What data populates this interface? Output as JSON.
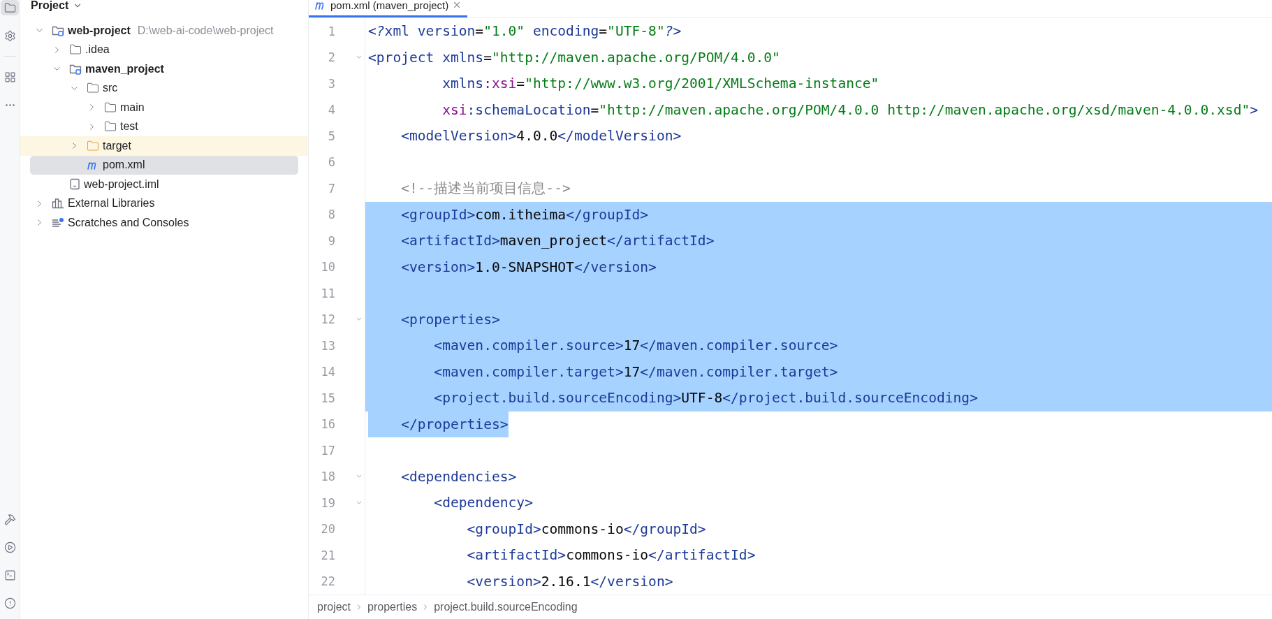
{
  "tool_strip": {
    "top": [
      {
        "kind": "project",
        "selected": true
      },
      {
        "kind": "settings",
        "selected": false
      },
      {
        "kind": "structure",
        "selected": false
      },
      {
        "kind": "more",
        "selected": false
      }
    ],
    "bottom": [
      {
        "kind": "build",
        "selected": false
      },
      {
        "kind": "services",
        "selected": false
      },
      {
        "kind": "terminal",
        "selected": false
      },
      {
        "kind": "problems",
        "selected": false
      }
    ]
  },
  "project_panel": {
    "title": "Project",
    "tree": [
      {
        "label": "web-project",
        "path": "D:\\web-ai-code\\web-project",
        "kind": "module",
        "expanded": true,
        "selected": false,
        "children": [
          {
            "label": ".idea",
            "kind": "folder",
            "expanded": false,
            "selected": false
          },
          {
            "label": "maven_project",
            "kind": "module",
            "expanded": true,
            "selected": false,
            "children": [
              {
                "label": "src",
                "kind": "folder",
                "expanded": true,
                "selected": false,
                "children": [
                  {
                    "label": "main",
                    "kind": "folder",
                    "expanded": false,
                    "selected": false
                  },
                  {
                    "label": "test",
                    "kind": "folder",
                    "expanded": false,
                    "selected": false
                  }
                ]
              },
              {
                "label": "target",
                "kind": "excluded_folder",
                "expanded": false,
                "selected": false
              },
              {
                "label": "pom.xml",
                "kind": "maven_file",
                "selected": true
              }
            ]
          },
          {
            "label": "web-project.iml",
            "kind": "iml_file",
            "selected": false
          }
        ]
      },
      {
        "label": "External Libraries",
        "kind": "libraries",
        "expanded": false,
        "selected": false
      },
      {
        "label": "Scratches and Consoles",
        "kind": "scratches",
        "expanded": false,
        "selected": false
      }
    ]
  },
  "editor": {
    "tab": {
      "title": "pom.xml (maven_project)",
      "selected": true
    },
    "lines": [
      {
        "number": "1",
        "selected": false,
        "fold": false,
        "tokens": [
          {
            "kind": "pi",
            "text": "<?"
          },
          {
            "kind": "tag",
            "text": "xml"
          },
          {
            "kind": "attr",
            "text": " version"
          },
          {
            "kind": "text",
            "text": "="
          },
          {
            "kind": "str",
            "text": "\"1.0\""
          },
          {
            "kind": "attr",
            "text": " encoding"
          },
          {
            "kind": "text",
            "text": "="
          },
          {
            "kind": "str",
            "text": "\"UTF-8\""
          },
          {
            "kind": "pi",
            "text": "?>"
          }
        ]
      },
      {
        "number": "2",
        "selected": false,
        "fold": true,
        "tokens": [
          {
            "kind": "tag",
            "text": "<project"
          },
          {
            "kind": "attr",
            "text": " xmlns"
          },
          {
            "kind": "text",
            "text": "="
          },
          {
            "kind": "str",
            "text": "\"http://maven.apache.org/POM/4.0.0\""
          }
        ]
      },
      {
        "number": "3",
        "selected": false,
        "fold": false,
        "tokens": [
          {
            "kind": "attr",
            "text": "         xmlns"
          },
          {
            "kind": "ns",
            "text": ":xsi"
          },
          {
            "kind": "text",
            "text": "="
          },
          {
            "kind": "str",
            "text": "\"http://www.w3.org/2001/XMLSchema-instance\""
          }
        ]
      },
      {
        "number": "4",
        "selected": false,
        "fold": false,
        "tokens": [
          {
            "kind": "ns",
            "text": "         xsi"
          },
          {
            "kind": "attr",
            "text": ":schemaLocation"
          },
          {
            "kind": "text",
            "text": "="
          },
          {
            "kind": "str",
            "text": "\"http://maven.apache.org/POM/4.0.0 http://maven.apache.org/xsd/maven-4.0.0.xsd\""
          },
          {
            "kind": "tag",
            "text": ">"
          }
        ]
      },
      {
        "number": "5",
        "selected": false,
        "fold": false,
        "tokens": [
          {
            "kind": "tag",
            "text": "    <modelVersion>"
          },
          {
            "kind": "text",
            "text": "4.0.0"
          },
          {
            "kind": "tag",
            "text": "</modelVersion>"
          }
        ]
      },
      {
        "number": "6",
        "selected": false,
        "fold": false
      },
      {
        "number": "7",
        "selected": false,
        "fold": false,
        "tokens": [
          {
            "kind": "comment",
            "text": "    <!--描述当前项目信息-->"
          }
        ]
      },
      {
        "number": "8",
        "selected": true,
        "fold": false,
        "tokens": [
          {
            "kind": "tag",
            "text": "    <groupId>"
          },
          {
            "kind": "text",
            "text": "com.itheima"
          },
          {
            "kind": "tag",
            "text": "</groupId>"
          }
        ]
      },
      {
        "number": "9",
        "selected": true,
        "fold": false,
        "tokens": [
          {
            "kind": "tag",
            "text": "    <artifactId>"
          },
          {
            "kind": "text",
            "text": "maven_project"
          },
          {
            "kind": "tag",
            "text": "</artifactId>"
          }
        ]
      },
      {
        "number": "10",
        "selected": true,
        "fold": false,
        "tokens": [
          {
            "kind": "tag",
            "text": "    <version>"
          },
          {
            "kind": "text",
            "text": "1.0-SNAPSHOT"
          },
          {
            "kind": "tag",
            "text": "</version>"
          }
        ]
      },
      {
        "number": "11",
        "selected": true,
        "fold": false
      },
      {
        "number": "12",
        "selected": true,
        "fold": true,
        "tokens": [
          {
            "kind": "tag",
            "text": "    <properties>"
          }
        ]
      },
      {
        "number": "13",
        "selected": true,
        "fold": false,
        "tokens": [
          {
            "kind": "tag",
            "text": "        <maven.compiler.source>"
          },
          {
            "kind": "text",
            "text": "17"
          },
          {
            "kind": "tag",
            "text": "</maven.compiler.source>"
          }
        ]
      },
      {
        "number": "14",
        "selected": true,
        "fold": false,
        "tokens": [
          {
            "kind": "tag",
            "text": "        <maven.compiler.target>"
          },
          {
            "kind": "text",
            "text": "17"
          },
          {
            "kind": "tag",
            "text": "</maven.compiler.target>"
          }
        ]
      },
      {
        "number": "15",
        "selected": true,
        "fold": false,
        "tokens": [
          {
            "kind": "tag",
            "text": "        <project.build.sourceEncoding>"
          },
          {
            "kind": "text",
            "text": "UTF-8"
          },
          {
            "kind": "tag",
            "text": "</project.build.sourceEncoding>"
          }
        ]
      },
      {
        "number": "16",
        "selected": true,
        "fold": false,
        "tokens": [
          {
            "kind": "tag",
            "text": "    </properties>"
          }
        ]
      },
      {
        "number": "17",
        "selected": false,
        "fold": false
      },
      {
        "number": "18",
        "selected": false,
        "fold": true,
        "tokens": [
          {
            "kind": "tag",
            "text": "    <dependencies>"
          }
        ]
      },
      {
        "number": "19",
        "selected": false,
        "fold": true,
        "tokens": [
          {
            "kind": "tag",
            "text": "        <dependency>"
          }
        ]
      },
      {
        "number": "20",
        "selected": false,
        "fold": false,
        "tokens": [
          {
            "kind": "tag",
            "text": "            <groupId>"
          },
          {
            "kind": "text",
            "text": "commons-io"
          },
          {
            "kind": "tag",
            "text": "</groupId>"
          }
        ]
      },
      {
        "number": "21",
        "selected": false,
        "fold": false,
        "tokens": [
          {
            "kind": "tag",
            "text": "            <artifactId>"
          },
          {
            "kind": "text",
            "text": "commons-io"
          },
          {
            "kind": "tag",
            "text": "</artifactId>"
          }
        ]
      },
      {
        "number": "22",
        "selected": false,
        "fold": false,
        "tokens": [
          {
            "kind": "tag",
            "text": "            <version>"
          },
          {
            "kind": "text",
            "text": "2.16.1"
          },
          {
            "kind": "tag",
            "text": "</version>"
          }
        ]
      }
    ],
    "breadcrumbs": [
      "project",
      "properties",
      "project.build.sourceEncoding"
    ]
  }
}
